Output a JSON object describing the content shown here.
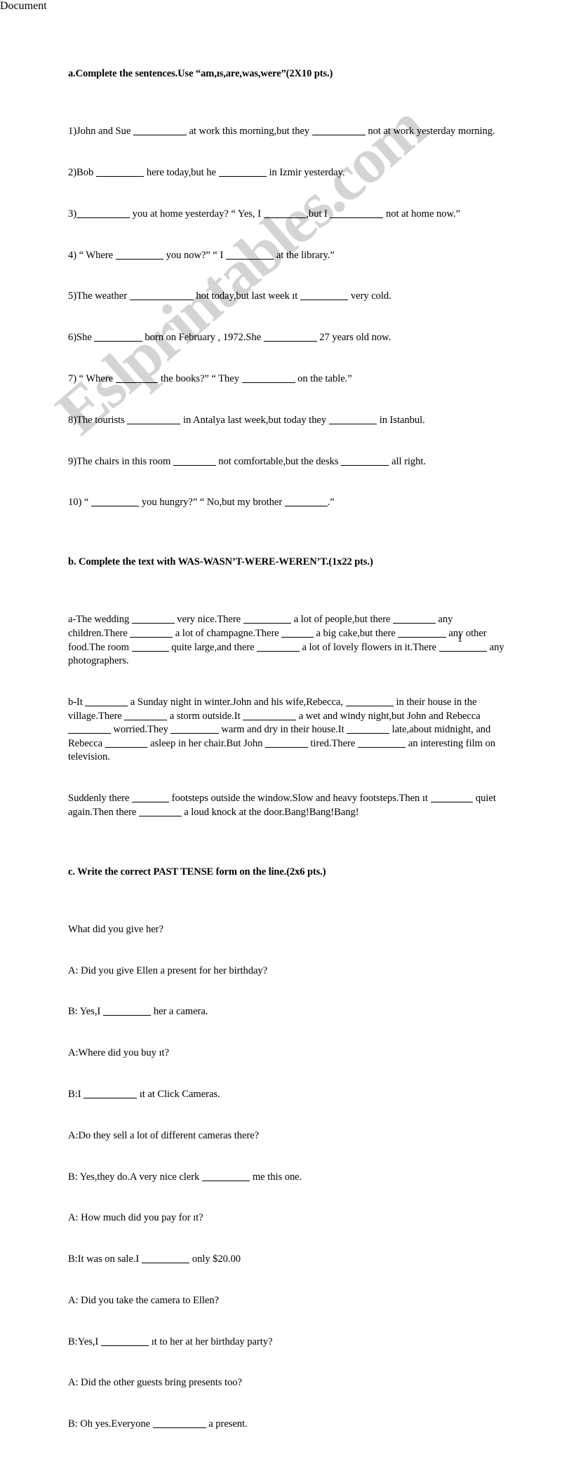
{
  "document": {
    "type": "esl-worksheet",
    "page_number": "1",
    "watermark_text": "Eslprintables.com",
    "watermark_color": "#d2d2d2",
    "text_color": "#000000",
    "background_color": "#ffffff"
  },
  "sections": [
    {
      "id": "a",
      "heading": "a.Complete the sentences.Use “am,ıs,are,was,were”(2X10 pts.)",
      "lines": [
        "1)John and Sue __________ at work this morning,but they __________ not at work yesterday morning.",
        "2)Bob _________ here today,but he _________ in Izmir yesterday.",
        "3)__________ you at home yesterday? “ Yes, I ________,but I __________ not at home now.”",
        "4) “ Where _________ you now?” “ I _________ at the library.”",
        "5)The weather ____________ hot today,but last week ıt _________ very cold.",
        "6)She _________ born on February , 1972.She __________ 27 years old now.",
        "7) “ Where ________ the books?” “ They __________ on the table.”",
        "8)The tourists __________ in Antalya last week,but today they _________ in Istanbul.",
        "9)The chairs in this room ________ not comfortable,but the desks _________ all right.",
        "10) “ _________ you hungry?” “ No,but my brother ________.”"
      ]
    },
    {
      "id": "b",
      "heading": "b. Complete the text with WAS-WASN’T-WERE-WEREN’T.(1x22 pts.)",
      "lines": [
        "a-The wedding ________ very nice.There _________ a lot of people,but there ________ any children.There ________ a lot of champagne.There ______ a big cake,but there _________ any other food.The room _______ quite large,and there ________ a lot of lovely flowers in it.There _________ any photographers.",
        "b-It ________ a Sunday night in winter.John and his wife,Rebecca, _________ in their house in the village.There ________ a storm outside.It __________ a wet and windy night,but John and Rebecca ________ worried.They _________ warm and dry in their house.It ________ late,about midnight, and Rebecca ________ asleep in her chair.But John ________ tired.There _________ an interesting film on television.",
        "Suddenly there _______ footsteps outside the window.Slow and heavy footsteps.Then ıt ________ quiet again.Then there ________ a loud knock at the door.Bang!Bang!Bang!"
      ]
    },
    {
      "id": "c",
      "heading": "c. Write the correct PAST TENSE form on the line.(2x6 pts.)",
      "lines": [
        "What did you give her?",
        "A: Did you give Ellen a present for her birthday?",
        "B: Yes,I _________ her a camera.",
        "A:Where did you buy ıt?",
        "B:I __________ ıt at Click Cameras.",
        "A:Do they sell a lot of different cameras there?",
        "B: Yes,they do.A very nice clerk _________ me this one.",
        "A: How much did you pay for ıt?",
        "B:It was on sale.I _________ only $20.00",
        "A: Did you take the camera to Ellen?",
        "B:Yes,I _________ ıt to her at her birthday party?",
        "A: Did the other guests bring presents too?",
        "B: Oh yes.Everyone __________ a present."
      ]
    }
  ]
}
